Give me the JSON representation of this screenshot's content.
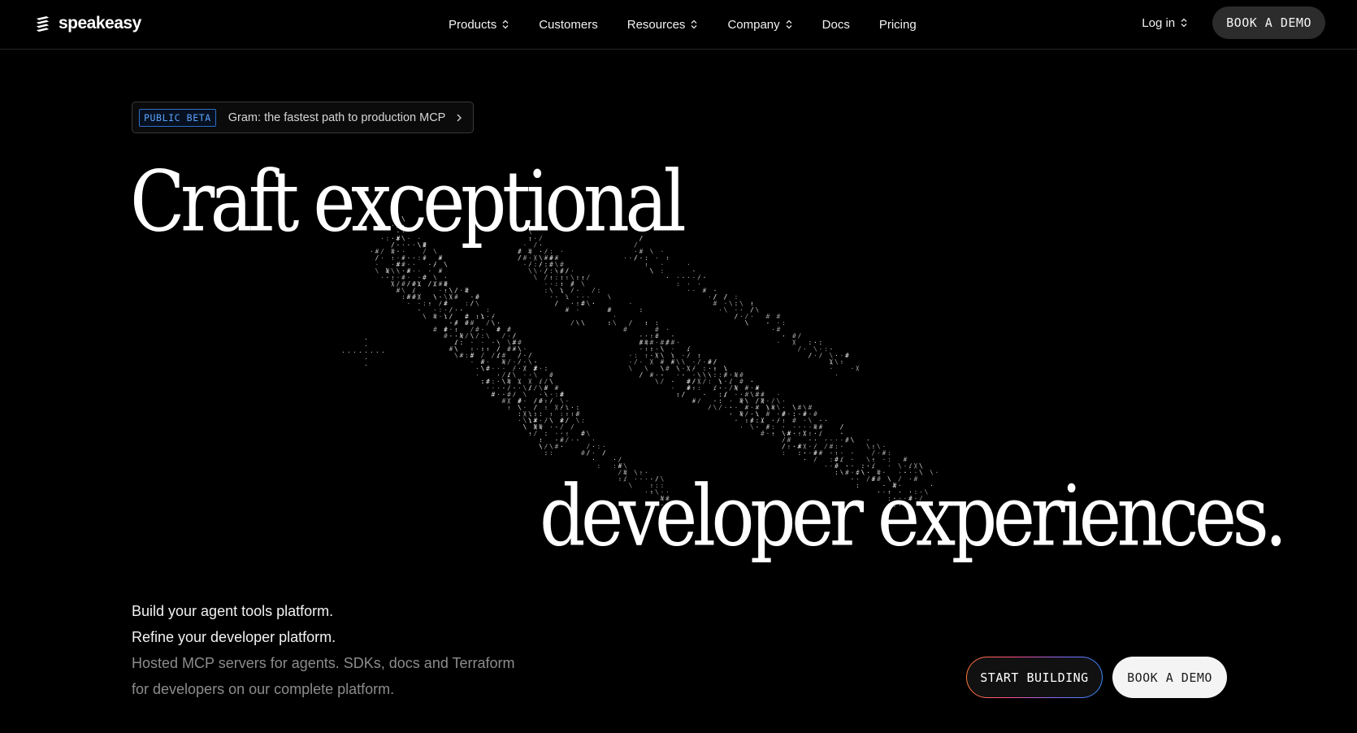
{
  "brand": {
    "name": "speakeasy",
    "logo_icon": "stacked-layers-icon"
  },
  "nav": {
    "items": [
      {
        "label": "Products",
        "has_dropdown": true
      },
      {
        "label": "Customers",
        "has_dropdown": false
      },
      {
        "label": "Resources",
        "has_dropdown": true
      },
      {
        "label": "Company",
        "has_dropdown": true
      },
      {
        "label": "Docs",
        "has_dropdown": false
      },
      {
        "label": "Pricing",
        "has_dropdown": false
      }
    ],
    "login_label": "Log in",
    "book_demo_label": "BOOK A DEMO"
  },
  "banner": {
    "badge": "PUBLIC BETA",
    "text": "Gram: the fastest path to production MCP",
    "arrow_icon": "chevron-right-icon"
  },
  "hero": {
    "headline_line1": "Craft exceptional",
    "headline_line2": "developer experiences.",
    "copy": [
      {
        "text": "Build your agent tools platform.",
        "tone": "primary"
      },
      {
        "text": "Refine your developer platform.",
        "tone": "primary"
      },
      {
        "text": "Hosted MCP servers for agents. SDKs, docs and Terraform",
        "tone": "muted"
      },
      {
        "text": "for developers on our complete platform.",
        "tone": "muted"
      }
    ],
    "start_building_label": "START BUILDING",
    "book_demo_label": "BOOK A DEMO"
  },
  "colors": {
    "background": "#000000",
    "text": "#ffffff",
    "muted_text": "#8c8c8c",
    "badge_blue": "#5aa4ff",
    "gradient_stops": [
      "#ff7a2e",
      "#ff4d8a",
      "#8f6bff",
      "#2f8cff"
    ]
  }
}
